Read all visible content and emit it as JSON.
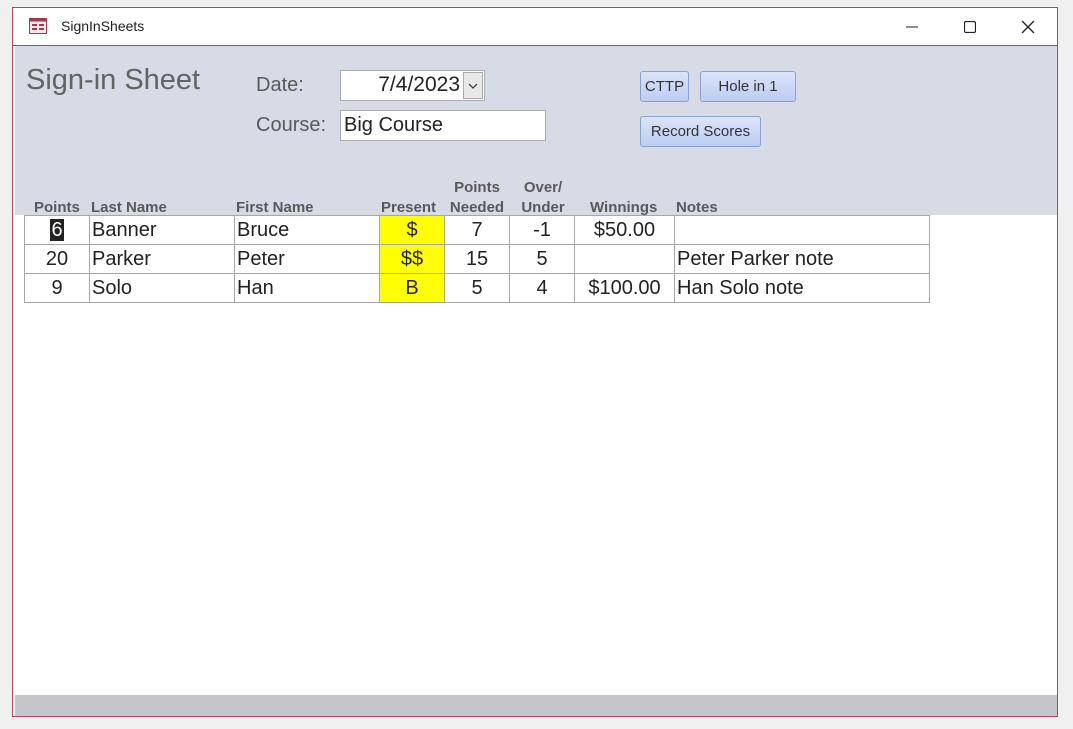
{
  "window": {
    "title": "SignInSheets",
    "icon": "access-form-icon",
    "controls": {
      "minimize": "minimize-icon",
      "maximize": "maximize-icon",
      "close": "close-icon"
    }
  },
  "form": {
    "title": "Sign-in Sheet",
    "date_label": "Date:",
    "date_value": "7/4/2023",
    "course_label": "Course:",
    "course_value": "Big Course",
    "buttons": {
      "cttp": "CTTP",
      "hole_in_1": "Hole in 1",
      "record_scores": "Record Scores"
    }
  },
  "table": {
    "headers": {
      "points": "Points",
      "last_name": "Last Name",
      "first_name": "First Name",
      "present": "Present",
      "points_needed_1": "Points",
      "points_needed_2": "Needed",
      "over_under_1": "Over/",
      "over_under_2": "Under",
      "winnings": "Winnings",
      "notes": "Notes"
    },
    "rows": [
      {
        "points": "6",
        "last": "Banner",
        "first": "Bruce",
        "present": "$",
        "needed": "7",
        "over_under": "-1",
        "winnings": "$50.00",
        "notes": ""
      },
      {
        "points": "20",
        "last": "Parker",
        "first": "Peter",
        "present": "$$",
        "needed": "15",
        "over_under": "5",
        "winnings": "",
        "notes": "Peter Parker note"
      },
      {
        "points": "9",
        "last": "Solo",
        "first": "Han",
        "present": "B",
        "needed": "5",
        "over_under": "4",
        "winnings": "$100.00",
        "notes": "Han Solo note"
      }
    ]
  },
  "colors": {
    "header_bg": "#d6dbe5",
    "present_bg": "#ffff00",
    "border_accent": "#b2475b"
  }
}
